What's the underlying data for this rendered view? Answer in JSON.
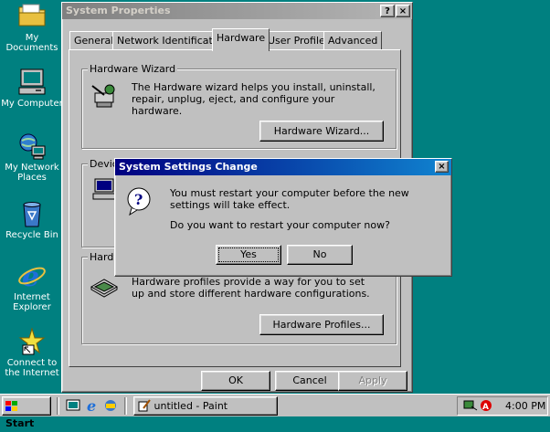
{
  "desktop": {
    "icons": [
      {
        "label": "My Documents"
      },
      {
        "label": "My Computer"
      },
      {
        "label": "My Network Places"
      },
      {
        "label": "Recycle Bin"
      },
      {
        "label": "Internet Explorer"
      },
      {
        "label": "Connect to the Internet"
      }
    ]
  },
  "sysprops": {
    "title": "System Properties",
    "help_btn": "?",
    "close_btn": "×",
    "tabs": [
      "General",
      "Network Identification",
      "Hardware",
      "User Profiles",
      "Advanced"
    ],
    "selected_tab": "Hardware",
    "wizard_group": {
      "title": "Hardware Wizard",
      "text": "The Hardware wizard helps you install, uninstall, repair, unplug, eject, and configure your hardware.",
      "button": "Hardware Wizard..."
    },
    "device_group": {
      "title": "Devic"
    },
    "profiles_group": {
      "title": "Hardw",
      "text": "Hardware profiles provide a way for you to set up and store different hardware configurations.",
      "button": "Hardware Profiles..."
    },
    "ok": "OK",
    "cancel": "Cancel",
    "apply": "Apply"
  },
  "dialog": {
    "title": "System Settings Change",
    "close_btn": "×",
    "message1": "You must restart your computer before the new settings will take effect.",
    "message2": "Do you want to restart your computer now?",
    "yes": "Yes",
    "no": "No"
  },
  "taskbar": {
    "start": "Start",
    "task": "untitled - Paint",
    "clock": "4:00 PM"
  }
}
